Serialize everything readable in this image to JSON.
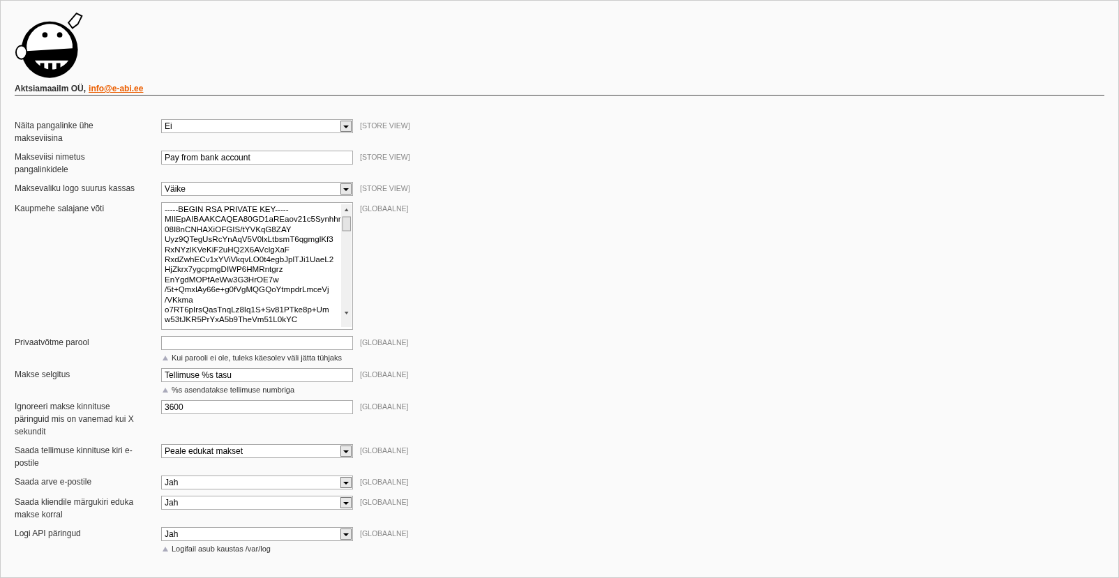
{
  "header": {
    "company": "Aktsiamaailm OÜ,",
    "email": "info@e-abi.ee"
  },
  "fields": [
    {
      "label": "Näita pangalinke ühe makseviisina",
      "kind": "select",
      "value": "Ei",
      "scope": "[STORE VIEW]"
    },
    {
      "label": "Makseviisi nimetus pangalinkidele",
      "kind": "text",
      "value": "Pay from bank account",
      "scope": "[STORE VIEW]"
    },
    {
      "label": "Maksevaliku logo suurus kassas",
      "kind": "select",
      "value": "Väike",
      "scope": "[STORE VIEW]"
    },
    {
      "label": "Kaupmehe salajane võti",
      "kind": "textarea",
      "lines": [
        "-----BEGIN RSA PRIVATE KEY-----",
        "MIIEpAIBAAKCAQEA80GD1aREaov21c5Synhhr",
        "08I8nCNHAXiOFGIS/tYVKqG8ZAY",
        "Uyz9QTegUsRcYnAqV5V0lxLtbsmT6qgmglKf3",
        "RxNYzlKVeKiF2uHQ2X6AVclgXaF",
        "RxdZwhECv1xYViVkqvLO0t4egbJplTJi1UaeL2",
        "HjZkrx7ygcpmgDIWP6HMRntgrz",
        "EnYgdMOPfAeWw3G3HrOE7w",
        "/5t+QmxlAy66e+g0fVgMQGQoYtmpdrLmceVj",
        "/VKkma",
        "o7RT6pIrsQasTnqLz8Iq1S+Sv81PTke8p+Um",
        "w53tJKR5PrYxA5b9TheVm51L0kYC"
      ],
      "scope": "[GLOBAALNE]"
    },
    {
      "label": "Privaatvõtme parool",
      "kind": "text",
      "scope": "[GLOBAALNE]",
      "note": "Kui parooli ei ole, tuleks käesolev väli jätta tühjaks"
    },
    {
      "label": "Makse selgitus",
      "kind": "text",
      "value": "Tellimuse %s tasu",
      "scope": "[GLOBAALNE]",
      "note": "%s asendatakse tellimuse numbriga"
    },
    {
      "label": "Ignoreeri makse kinnituse päringuid mis on vanemad kui X sekundit",
      "kind": "text",
      "value": "3600",
      "scope": "[GLOBAALNE]"
    },
    {
      "label": "Saada tellimuse kinnituse kiri e-postile",
      "kind": "select",
      "value": "Peale edukat makset",
      "scope": "[GLOBAALNE]"
    },
    {
      "label": "Saada arve e-postile",
      "kind": "select",
      "value": "Jah",
      "scope": "[GLOBAALNE]"
    },
    {
      "label": "Saada kliendile märgukiri eduka makse korral",
      "kind": "select",
      "value": "Jah",
      "scope": "[GLOBAALNE]"
    },
    {
      "label": "Logi API päringud",
      "kind": "select",
      "value": "Jah",
      "scope": "[GLOBAALNE]",
      "note": "Logifail asub kaustas /var/log"
    }
  ]
}
